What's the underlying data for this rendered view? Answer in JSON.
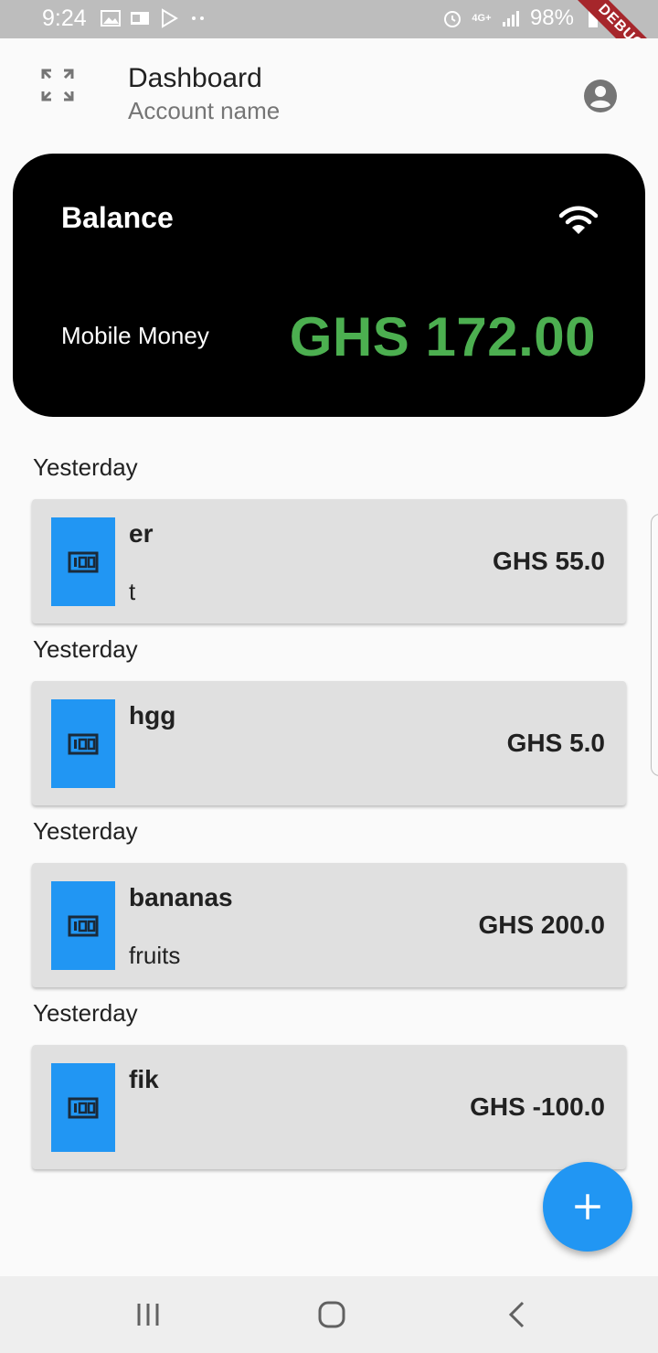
{
  "status_bar": {
    "time": "9:24",
    "network": "4G+",
    "battery": "98%",
    "debug_banner": "DEBUG",
    "left_icons": [
      "image-icon",
      "outlook-icon",
      "play-store-icon",
      "more-dots-icon"
    ],
    "right_icons": [
      "alarm-icon",
      "signal-icon",
      "battery-charging-icon"
    ]
  },
  "app_bar": {
    "title": "Dashboard",
    "subtitle": "Account name",
    "leading_icon": "fullscreen-icon",
    "trailing_icon": "account-circle-icon"
  },
  "balance_card": {
    "title": "Balance",
    "label": "Mobile Money",
    "amount": "GHS 172.00",
    "amount_color": "#4caf50",
    "icon": "wifi-icon"
  },
  "transactions": [
    {
      "date": "Yesterday",
      "title": "er",
      "subtitle": "t",
      "amount": "GHS 55.0",
      "icon": "money-icon"
    },
    {
      "date": "Yesterday",
      "title": "hgg",
      "subtitle": "",
      "amount": "GHS 5.0",
      "icon": "money-icon"
    },
    {
      "date": "Yesterday",
      "title": "bananas",
      "subtitle": "fruits",
      "amount": "GHS 200.0",
      "icon": "money-icon"
    },
    {
      "date": "Yesterday",
      "title": "fik",
      "subtitle": "",
      "amount": "GHS -100.0",
      "icon": "money-icon"
    }
  ],
  "fab": {
    "icon": "add-icon",
    "color": "#2196f3"
  },
  "nav_bar": {
    "buttons": [
      "recents-icon",
      "home-icon",
      "back-icon"
    ]
  },
  "colors": {
    "accent": "#2196f3",
    "card_bg": "#e0e0e0",
    "balance_card_bg": "#000000"
  }
}
